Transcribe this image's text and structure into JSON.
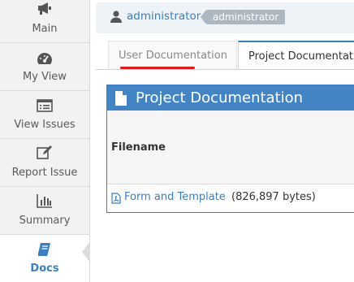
{
  "sidebar": {
    "items": [
      {
        "label": "Main",
        "icon": "megaphone-icon"
      },
      {
        "label": "My View",
        "icon": "dashboard-icon"
      },
      {
        "label": "View Issues",
        "icon": "list-icon"
      },
      {
        "label": "Report Issue",
        "icon": "edit-icon"
      },
      {
        "label": "Summary",
        "icon": "bar-chart-icon"
      },
      {
        "label": "Docs",
        "icon": "book-icon",
        "active": true
      }
    ]
  },
  "header": {
    "username": "administrator",
    "role": "administrator"
  },
  "tabs": [
    {
      "label": "User Documentation",
      "active": false
    },
    {
      "label": "Project Documentation",
      "active": true
    }
  ],
  "widget": {
    "title": "Project Documentation",
    "column_header": "Filename",
    "files": [
      {
        "name": "Form and Template",
        "size": "(826,897 bytes)"
      }
    ]
  },
  "colors": {
    "accent": "#3a7fc1",
    "widget_header": "#4384c4",
    "active_tab_underline": "#d61c1c"
  }
}
